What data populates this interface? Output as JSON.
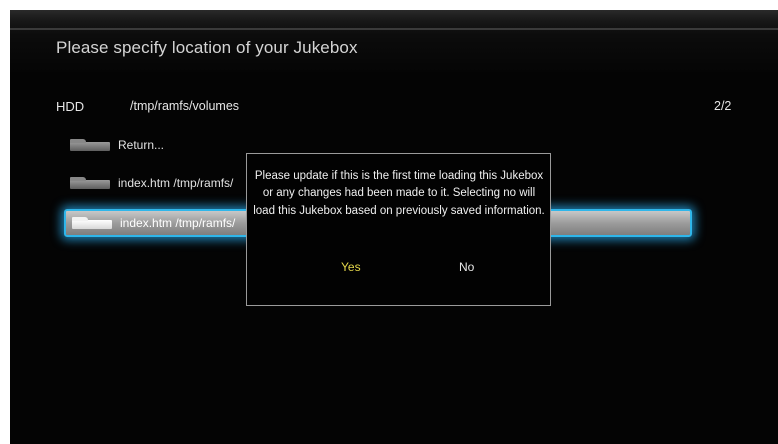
{
  "header": {
    "title": "Please specify location of your Jukebox"
  },
  "location": {
    "drive": "HDD",
    "path": "/tmp/ramfs/volumes",
    "page": "2/2"
  },
  "files": [
    {
      "label": "Return..."
    },
    {
      "label": "index.htm  /tmp/ramfs/"
    },
    {
      "label": "index.htm  /tmp/ramfs/"
    }
  ],
  "dialog": {
    "message": "Please update if this is the first time loading this Jukebox or any changes had been made to it.   Selecting no will load this Jukebox based on previously saved information.",
    "yes_label": "Yes",
    "no_label": "No"
  },
  "colors": {
    "focus_glow": "#2fb6ea",
    "selected_button_text": "#e3d64a",
    "background": "#040404"
  },
  "icons": {
    "folder": "folder-icon"
  }
}
